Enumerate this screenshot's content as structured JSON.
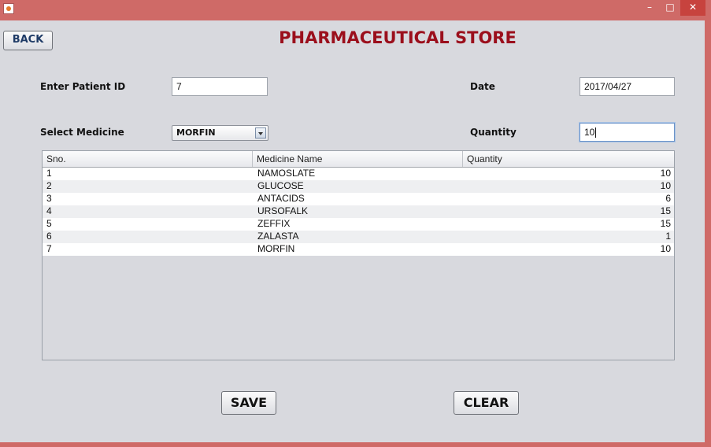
{
  "window": {
    "controls": {
      "minimize": "–",
      "maximize": "□",
      "close": "✕"
    }
  },
  "header": {
    "back_label": "BACK",
    "title": "PHARMACEUTICAL STORE"
  },
  "form": {
    "patient_id_label": "Enter Patient ID",
    "patient_id_value": "7",
    "date_label": "Date",
    "date_value": "2017/04/27",
    "medicine_label": "Select Medicine",
    "medicine_value": "MORFIN",
    "quantity_label": "Quantity",
    "quantity_value": "10"
  },
  "table": {
    "columns": [
      "Sno.",
      "Medicine Name",
      "Quantity"
    ],
    "rows": [
      {
        "sno": "1",
        "name": "NAMOSLATE",
        "qty": "10"
      },
      {
        "sno": "2",
        "name": "GLUCOSE",
        "qty": "10"
      },
      {
        "sno": "3",
        "name": "ANTACIDS",
        "qty": "6"
      },
      {
        "sno": "4",
        "name": "URSOFALK",
        "qty": "15"
      },
      {
        "sno": "5",
        "name": "ZEFFIX",
        "qty": "15"
      },
      {
        "sno": "6",
        "name": "ZALASTA",
        "qty": "1"
      },
      {
        "sno": "7",
        "name": "MORFIN",
        "qty": "10"
      }
    ]
  },
  "actions": {
    "save_label": "SAVE",
    "clear_label": "CLEAR"
  },
  "colors": {
    "title": "#9b0f1c",
    "titlebar": "#cf6a67",
    "background": "#d8d9de"
  },
  "icons": [
    "java-app-icon",
    "minimize-icon",
    "maximize-icon",
    "close-icon",
    "chevron-down-icon"
  ]
}
